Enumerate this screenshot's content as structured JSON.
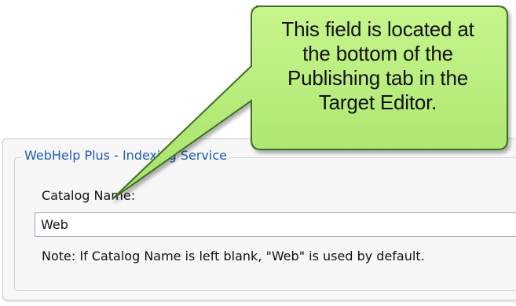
{
  "group": {
    "title": "WebHelp Plus - Indexing Service"
  },
  "catalog": {
    "label": "Catalog Name:",
    "value": "Web"
  },
  "note": "Note: If Catalog Name is left blank, \"Web\" is used by default.",
  "callout": {
    "lines": [
      "This field is located at",
      "the bottom of the",
      "Publishing tab in the",
      "Target Editor."
    ],
    "fill_color": "#b8ee7c",
    "border_color": "#3c6e23"
  }
}
